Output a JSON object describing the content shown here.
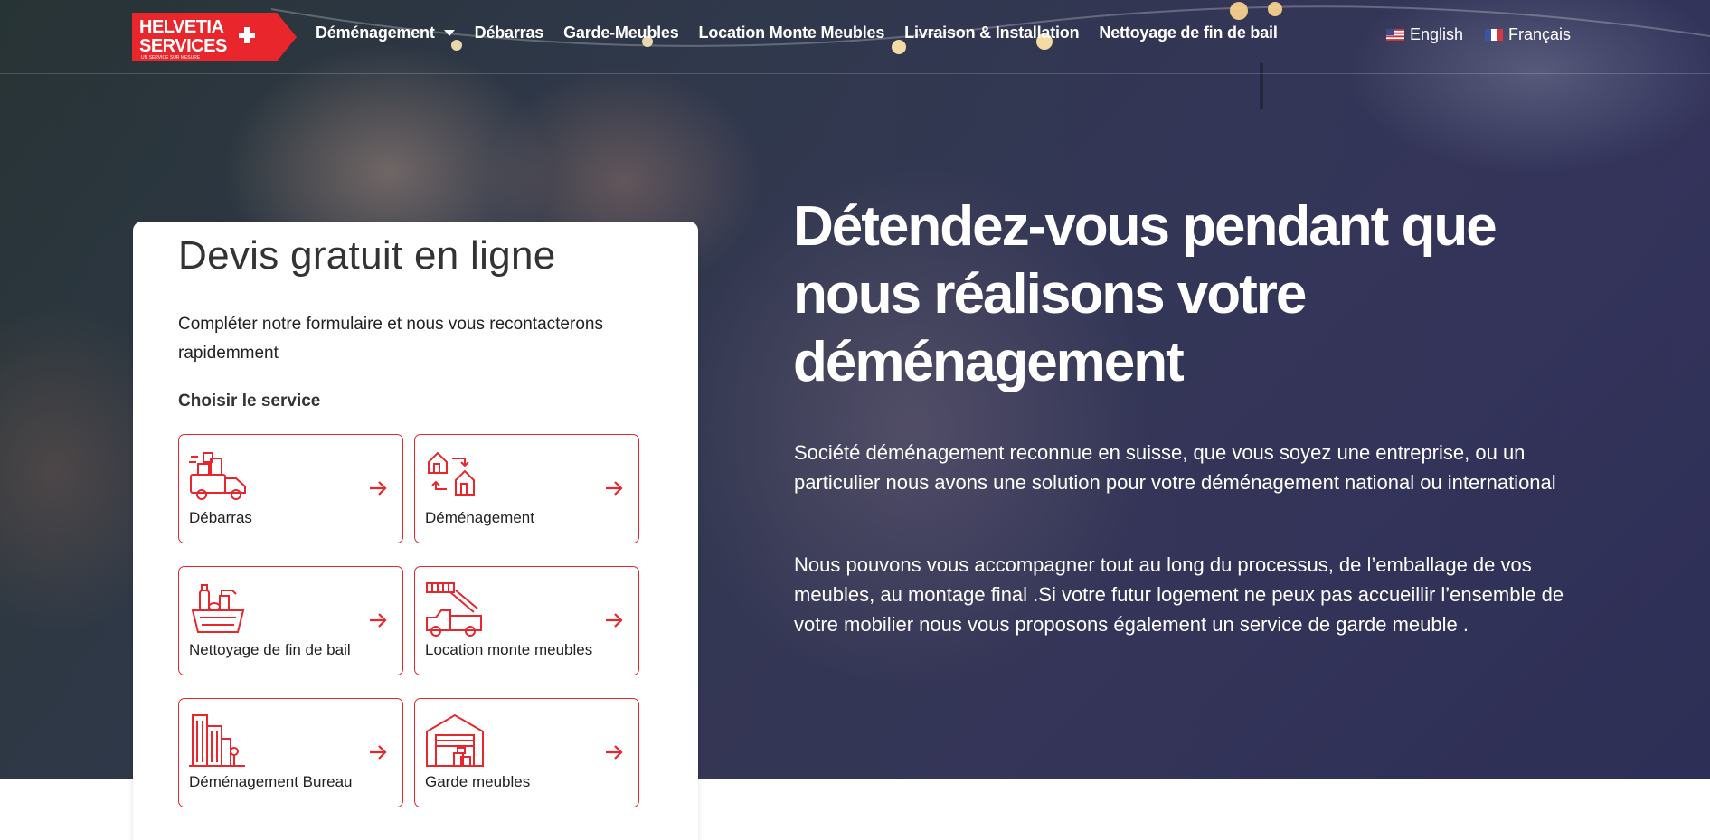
{
  "brand": {
    "logo_line1": "HELVETIA",
    "logo_line2": "SERVICES",
    "logo_tagline": "UN SERVICE SUR MESURE",
    "accent_color": "#e8262b"
  },
  "nav": {
    "items": [
      {
        "label": "Déménagement",
        "has_dropdown": true
      },
      {
        "label": "Débarras"
      },
      {
        "label": "Garde-Meubles"
      },
      {
        "label": "Location Monte Meubles"
      },
      {
        "label": "Livraison & Installation"
      },
      {
        "label": "Nettoyage de fin de bail"
      }
    ],
    "languages": [
      {
        "label": "English",
        "icon": "us-flag-icon"
      },
      {
        "label": "Français",
        "icon": "fr-flag-icon"
      }
    ]
  },
  "hero": {
    "headline": "Détendez-vous pendant que nous réalisons votre déménagement",
    "paragraph_1": "Société déménagement reconnue en suisse, que vous soyez une entreprise, ou un particulier nous avons une solution pour votre déménagement national ou international",
    "paragraph_2": "Nous pouvons vous accompagner tout au long du processus, de l’emballage de vos meubles, au montage final .Si votre futur logement ne peux pas accueillir l’ensemble de votre mobilier nous vous proposons également un service de garde meuble ."
  },
  "form": {
    "title": "Devis gratuit en ligne",
    "description": "Compléter notre formulaire et nous vous recontacterons rapidemment",
    "choose_label": "Choisir le service",
    "services": [
      {
        "label": "Débarras",
        "icon": "truck-boxes-icon"
      },
      {
        "label": "Déménagement",
        "icon": "house-swap-icon"
      },
      {
        "label": "Nettoyage de fin de bail",
        "icon": "cleaning-basket-icon"
      },
      {
        "label": "Location monte meubles",
        "icon": "ladder-truck-icon"
      },
      {
        "label": "Déménagement Bureau",
        "icon": "office-building-icon"
      },
      {
        "label": "Garde meubles",
        "icon": "storage-garage-icon"
      }
    ]
  }
}
